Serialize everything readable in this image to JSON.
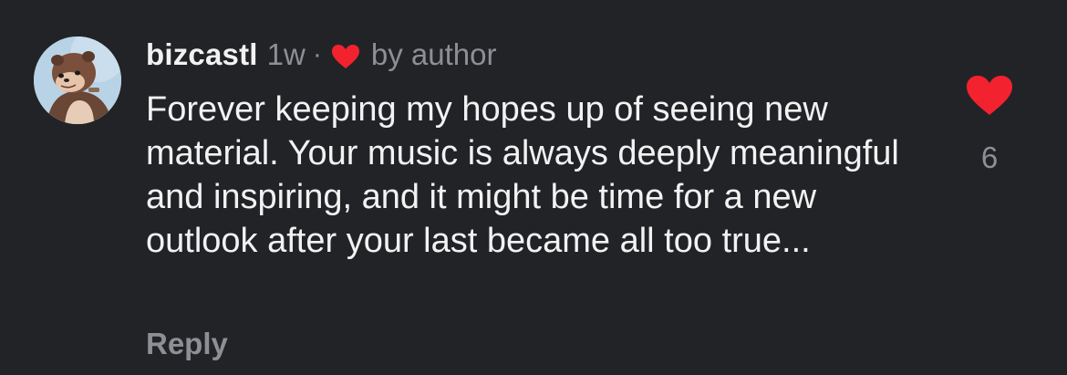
{
  "comment": {
    "username": "bizcastl",
    "time": "1w",
    "separator": "·",
    "author_liked_label": "by author",
    "text": "Forever keeping my hopes up of seeing new material. Your music is always deeply meaningful and inspiring, and it might be time for a new outlook after your last became all too true...",
    "reply_label": "Reply",
    "like_count": "6",
    "avatar_icon": "otter-avatar",
    "heart_icon": "heart-icon"
  },
  "colors": {
    "background": "#222327",
    "primary_text": "#f2f2f2",
    "secondary_text": "#8e8f94",
    "heart": "#f3222f"
  }
}
